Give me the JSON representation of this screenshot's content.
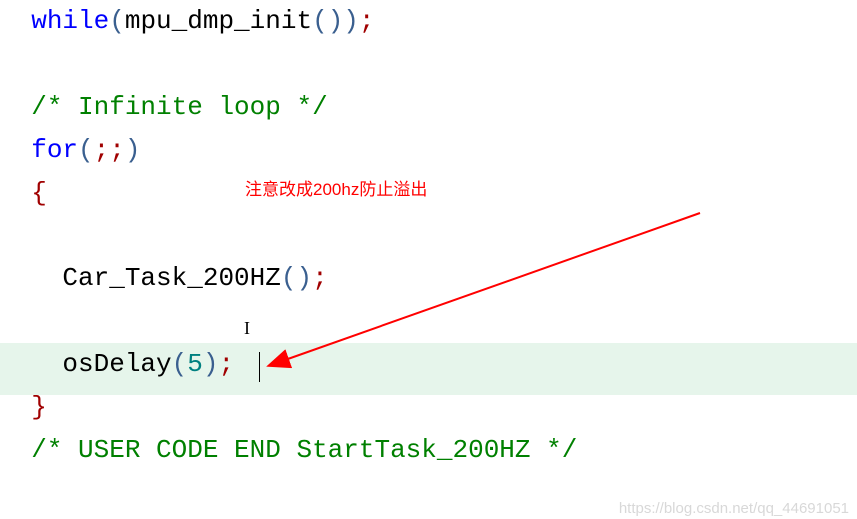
{
  "code": {
    "line1": {
      "indent": "  ",
      "while": "while",
      "lparen": "(",
      "fn": "mpu_dmp_init",
      "lparen2": "(",
      "rparen2": ")",
      "rparen": ")",
      "semi": ";"
    },
    "line3": {
      "indent": "  ",
      "comment": "/* Infinite loop */"
    },
    "line4": {
      "indent": "  ",
      "for": "for",
      "lparen": "(",
      "semi1": ";",
      "semi2": ";",
      "rparen": ")"
    },
    "line5": {
      "indent": "  ",
      "brace": "{"
    },
    "line7": {
      "indent": "    ",
      "fn": "Car_Task_200HZ",
      "lparen": "(",
      "rparen": ")",
      "semi": ";"
    },
    "line9": {
      "indent": "    ",
      "fn": "osDelay",
      "lparen": "(",
      "arg": "5",
      "rparen": ")",
      "semi": ";"
    },
    "line10": {
      "indent": "  ",
      "brace": "}"
    },
    "line11": {
      "indent": "  ",
      "comment": "/* USER CODE END StartTask_200HZ */"
    }
  },
  "annotation": "注意改成200hz防止溢出",
  "watermark": "https://blog.csdn.net/qq_44691051"
}
